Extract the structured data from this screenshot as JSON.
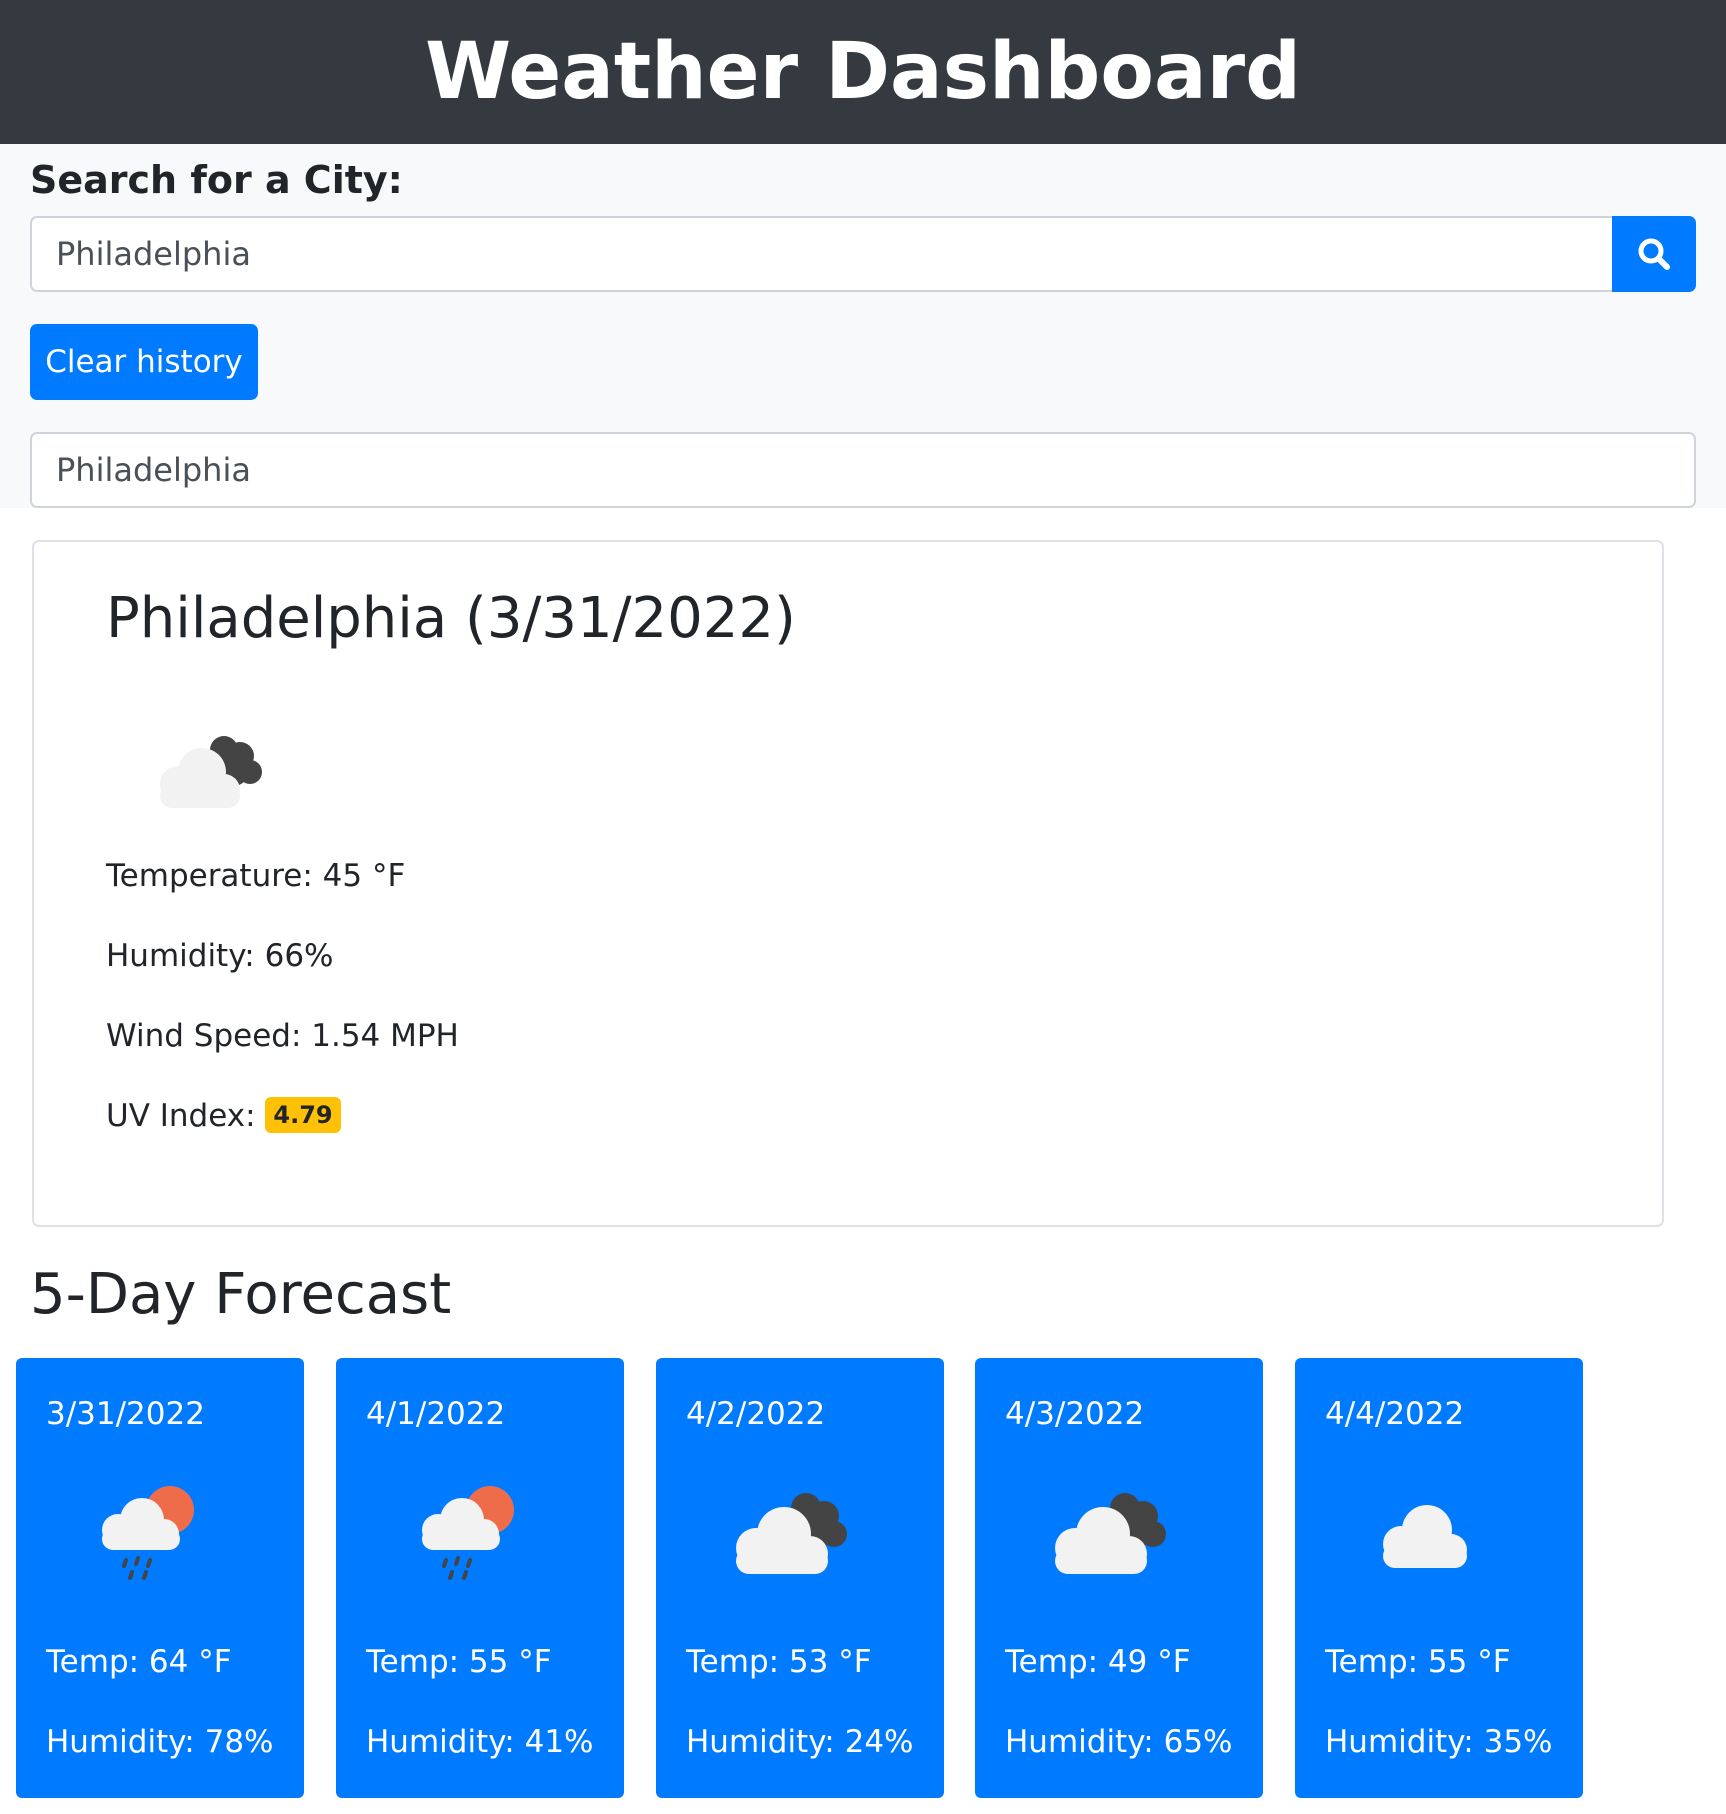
{
  "header": {
    "title": "Weather Dashboard"
  },
  "search": {
    "label": "Search for a City:",
    "value": "Philadelphia",
    "button_icon": "search-icon",
    "clear_label": "Clear history",
    "history": [
      "Philadelphia"
    ]
  },
  "current": {
    "title": "Philadelphia (3/31/2022)",
    "icon": "cloudy-night-icon",
    "temperature": "Temperature: 45 °F",
    "humidity": "Humidity: 66%",
    "wind": "Wind Speed: 1.54 MPH",
    "uv_label": "UV Index:",
    "uv_value": "4.79",
    "uv_color": "#ffc107"
  },
  "forecast": {
    "title": "5-Day Forecast",
    "days": [
      {
        "date": "3/31/2022",
        "icon": "rain-sun-icon",
        "temp": "Temp: 64 °F",
        "humidity": "Humidity: 78%"
      },
      {
        "date": "4/1/2022",
        "icon": "rain-sun-icon",
        "temp": "Temp: 55 °F",
        "humidity": "Humidity: 41%"
      },
      {
        "date": "4/2/2022",
        "icon": "broken-clouds-icon",
        "temp": "Temp: 53 °F",
        "humidity": "Humidity: 24%"
      },
      {
        "date": "4/3/2022",
        "icon": "broken-clouds-icon",
        "temp": "Temp: 49 °F",
        "humidity": "Humidity: 65%"
      },
      {
        "date": "4/4/2022",
        "icon": "cloud-icon",
        "temp": "Temp: 55 °F",
        "humidity": "Humidity: 35%"
      }
    ]
  },
  "colors": {
    "header_bg": "#343a40",
    "primary": "#007bff",
    "search_area_bg": "#f8f9fa",
    "uv_badge": "#ffc107"
  }
}
